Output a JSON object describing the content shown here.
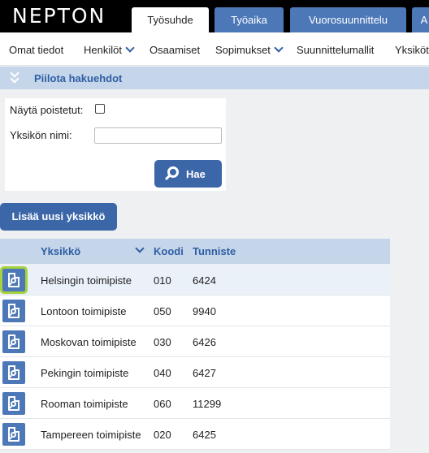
{
  "header": {
    "logo": "NEPTON",
    "tabs": [
      "Työsuhde",
      "Työaika",
      "Vuorosuunnittelu",
      "A"
    ]
  },
  "nav": {
    "items": [
      "Omat tiedot",
      "Henkilöt",
      "Osaamiset",
      "Sopimukset",
      "Suunnittelumallit",
      "Yksiköt"
    ]
  },
  "search": {
    "toggle_label": "Piilota hakuehdot",
    "show_deleted_label": "Näytä poistetut:",
    "show_deleted_checked": false,
    "unit_name_label": "Yksikön nimi:",
    "unit_name_value": "",
    "search_button": "Hae"
  },
  "add_button": "Lisää uusi yksikkö",
  "table": {
    "columns": [
      "Yksikkö",
      "Koodi",
      "Tunniste"
    ],
    "rows": [
      {
        "name": "Helsingin toimipiste",
        "code": "010",
        "id": "6424"
      },
      {
        "name": "Lontoon toimipiste",
        "code": "050",
        "id": "9940"
      },
      {
        "name": "Moskovan toimipiste",
        "code": "030",
        "id": "6426"
      },
      {
        "name": "Pekingin toimipiste",
        "code": "040",
        "id": "6427"
      },
      {
        "name": "Rooman toimipiste",
        "code": "060",
        "id": "11299"
      },
      {
        "name": "Tampereen toimipiste",
        "code": "020",
        "id": "6425"
      }
    ]
  },
  "colors": {
    "accent": "#3b66a8",
    "tab_blue": "#4d78b8",
    "header_light": "#c5d6ea",
    "selection_highlight": "#a6d23c"
  }
}
